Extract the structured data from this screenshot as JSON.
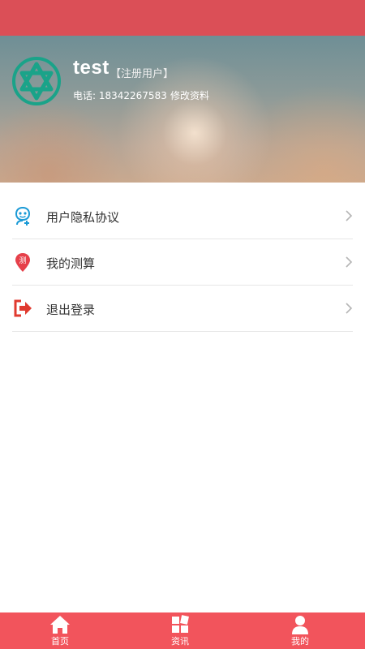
{
  "profile": {
    "username": "test",
    "user_tag": "【注册用户】",
    "phone": "电话: 18342267583",
    "edit_label": "修改资料"
  },
  "menu": {
    "items": [
      {
        "label": "用户隐私协议",
        "icon": "privacy-user-icon"
      },
      {
        "label": "我的测算",
        "icon": "calculation-pin-icon"
      },
      {
        "label": "退出登录",
        "icon": "logout-icon"
      }
    ]
  },
  "tabbar": {
    "tabs": [
      {
        "label": "首页",
        "icon": "home-icon"
      },
      {
        "label": "资讯",
        "icon": "news-grid-icon"
      },
      {
        "label": "我的",
        "icon": "profile-icon"
      }
    ]
  },
  "colors": {
    "status_bar": "#db4f57",
    "tab_bar": "#f2545c",
    "avatar_teal": "#1aa389",
    "privacy_icon": "#1a9ad6",
    "calc_icon": "#e6404a",
    "logout_icon": "#e03a2f"
  }
}
